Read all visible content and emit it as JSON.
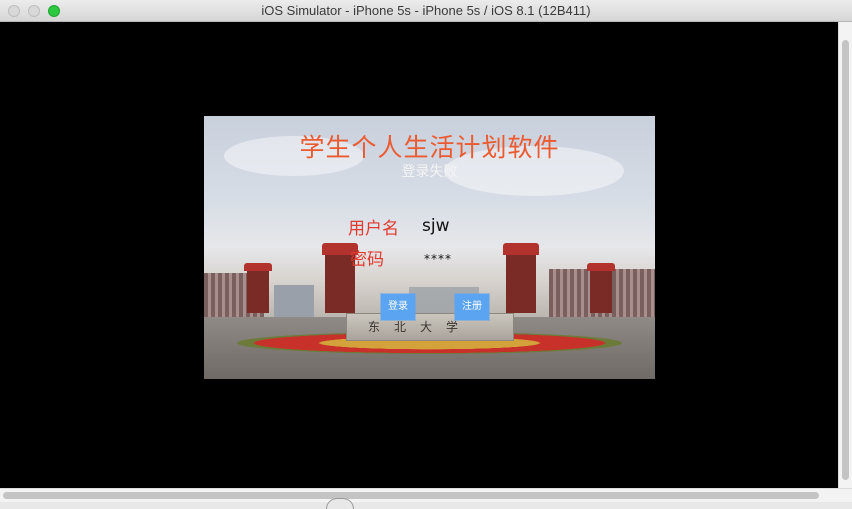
{
  "window": {
    "title": "iOS Simulator - iPhone 5s - iPhone 5s / iOS 8.1 (12B411)"
  },
  "app": {
    "title": "学生个人生活计划软件",
    "status": "登录失败",
    "username_label": "用户名",
    "username_value": "sjw",
    "password_label": "密码",
    "password_value": "****",
    "login_button": "登录",
    "register_button": "注册",
    "background_sign": "东北大学"
  },
  "colors": {
    "title_text": "#ec5a30",
    "label_text": "#e23a2e",
    "button": "#5aa4f2",
    "zoom_button": "#2bc840"
  }
}
